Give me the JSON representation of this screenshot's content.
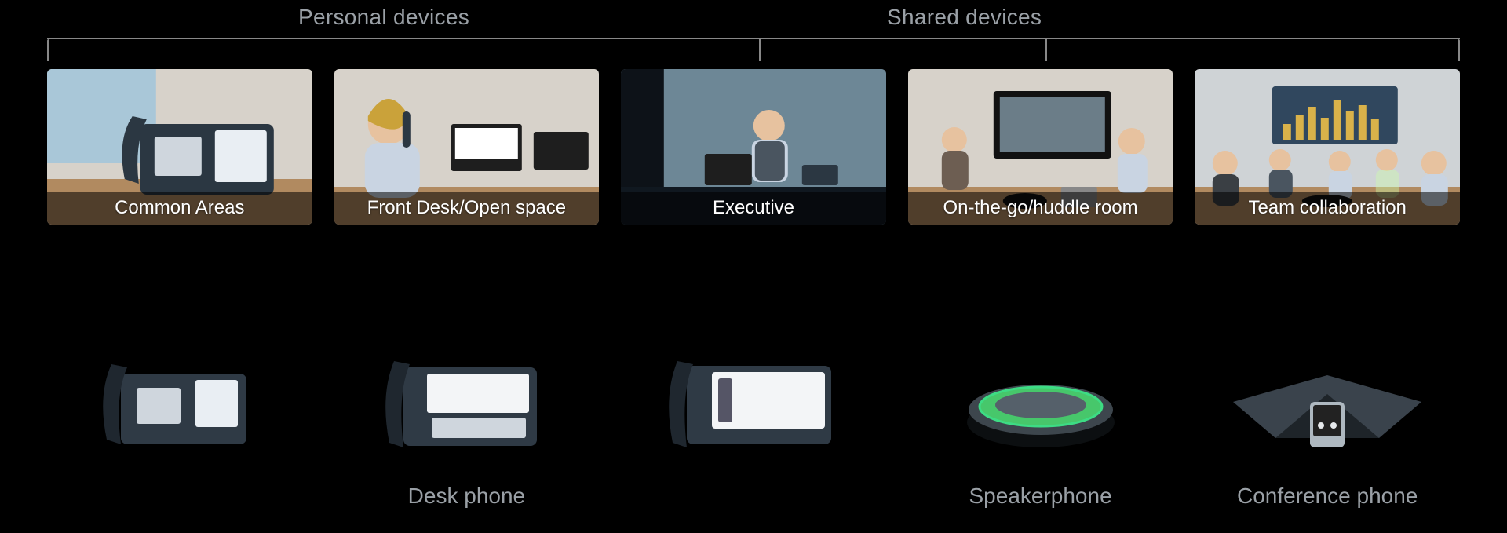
{
  "categories": {
    "personal": {
      "label": "Personal devices"
    },
    "shared": {
      "label": "Shared devices"
    }
  },
  "scenes": [
    {
      "caption": "Common Areas",
      "icon": "office-deskphone-photo"
    },
    {
      "caption": "Front Desk/Open space",
      "icon": "receptionist-photo"
    },
    {
      "caption": "Executive",
      "icon": "executive-desk-photo"
    },
    {
      "caption": "On-the-go/huddle room",
      "icon": "huddle-room-photo"
    },
    {
      "caption": "Team collaboration",
      "icon": "meeting-room-photo"
    }
  ],
  "products": [
    {
      "label": "",
      "icon": "deskphone-a-icon"
    },
    {
      "label": "Desk phone",
      "icon": "deskphone-b-icon"
    },
    {
      "label": "",
      "icon": "deskphone-c-icon"
    },
    {
      "label": "Speakerphone",
      "icon": "speakerphone-icon"
    },
    {
      "label": "Conference phone",
      "icon": "conference-phone-icon"
    }
  ]
}
